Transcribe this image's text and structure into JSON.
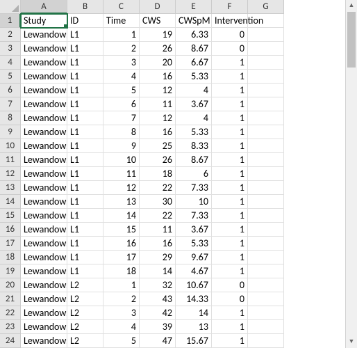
{
  "columns": [
    "A",
    "B",
    "C",
    "D",
    "E",
    "F",
    "G"
  ],
  "active_cell": "A1",
  "headers": {
    "A": "Study",
    "B": "ID",
    "C": "Time",
    "D": "CWS",
    "E": "CWSpM",
    "F": "Intervention",
    "G": ""
  },
  "rows": [
    {
      "n": 2,
      "A": "Lewandowski",
      "B": "L1",
      "C": 1,
      "D": 19,
      "E": "6.33",
      "F": 0
    },
    {
      "n": 3,
      "A": "Lewandowski",
      "B": "L1",
      "C": 2,
      "D": 26,
      "E": "8.67",
      "F": 0
    },
    {
      "n": 4,
      "A": "Lewandowski",
      "B": "L1",
      "C": 3,
      "D": 20,
      "E": "6.67",
      "F": 1
    },
    {
      "n": 5,
      "A": "Lewandowski",
      "B": "L1",
      "C": 4,
      "D": 16,
      "E": "5.33",
      "F": 1
    },
    {
      "n": 6,
      "A": "Lewandowski",
      "B": "L1",
      "C": 5,
      "D": 12,
      "E": "4",
      "F": 1
    },
    {
      "n": 7,
      "A": "Lewandowski",
      "B": "L1",
      "C": 6,
      "D": 11,
      "E": "3.67",
      "F": 1
    },
    {
      "n": 8,
      "A": "Lewandowski",
      "B": "L1",
      "C": 7,
      "D": 12,
      "E": "4",
      "F": 1
    },
    {
      "n": 9,
      "A": "Lewandowski",
      "B": "L1",
      "C": 8,
      "D": 16,
      "E": "5.33",
      "F": 1
    },
    {
      "n": 10,
      "A": "Lewandowski",
      "B": "L1",
      "C": 9,
      "D": 25,
      "E": "8.33",
      "F": 1
    },
    {
      "n": 11,
      "A": "Lewandowski",
      "B": "L1",
      "C": 10,
      "D": 26,
      "E": "8.67",
      "F": 1
    },
    {
      "n": 12,
      "A": "Lewandowski",
      "B": "L1",
      "C": 11,
      "D": 18,
      "E": "6",
      "F": 1
    },
    {
      "n": 13,
      "A": "Lewandowski",
      "B": "L1",
      "C": 12,
      "D": 22,
      "E": "7.33",
      "F": 1
    },
    {
      "n": 14,
      "A": "Lewandowski",
      "B": "L1",
      "C": 13,
      "D": 30,
      "E": "10",
      "F": 1
    },
    {
      "n": 15,
      "A": "Lewandowski",
      "B": "L1",
      "C": 14,
      "D": 22,
      "E": "7.33",
      "F": 1
    },
    {
      "n": 16,
      "A": "Lewandowski",
      "B": "L1",
      "C": 15,
      "D": 11,
      "E": "3.67",
      "F": 1
    },
    {
      "n": 17,
      "A": "Lewandowski",
      "B": "L1",
      "C": 16,
      "D": 16,
      "E": "5.33",
      "F": 1
    },
    {
      "n": 18,
      "A": "Lewandowski",
      "B": "L1",
      "C": 17,
      "D": 29,
      "E": "9.67",
      "F": 1
    },
    {
      "n": 19,
      "A": "Lewandowski",
      "B": "L1",
      "C": 18,
      "D": 14,
      "E": "4.67",
      "F": 1
    },
    {
      "n": 20,
      "A": "Lewandowski",
      "B": "L2",
      "C": 1,
      "D": 32,
      "E": "10.67",
      "F": 0
    },
    {
      "n": 21,
      "A": "Lewandowski",
      "B": "L2",
      "C": 2,
      "D": 43,
      "E": "14.33",
      "F": 0
    },
    {
      "n": 22,
      "A": "Lewandowski",
      "B": "L2",
      "C": 3,
      "D": 42,
      "E": "14",
      "F": 1
    },
    {
      "n": 23,
      "A": "Lewandowski",
      "B": "L2",
      "C": 4,
      "D": 39,
      "E": "13",
      "F": 1
    },
    {
      "n": 24,
      "A": "Lewandowski",
      "B": "L2",
      "C": 5,
      "D": 47,
      "E": "15.67",
      "F": 1
    }
  ],
  "row1_label": "1"
}
